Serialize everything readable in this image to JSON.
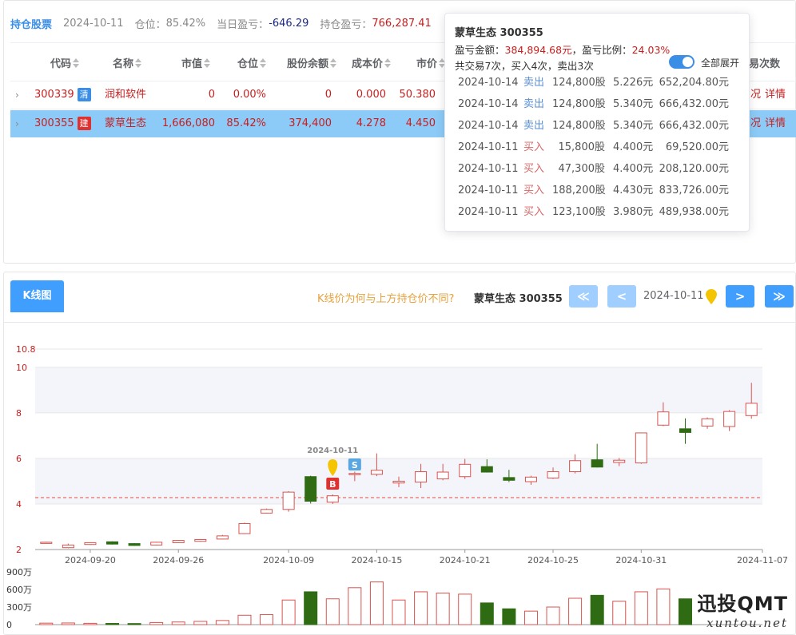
{
  "summary": {
    "title": "持仓股票",
    "date": "2024-10-11",
    "position_label": "仓位：",
    "position_value": "85.42%",
    "daily_pnl_label": "当日盈亏：",
    "daily_pnl_value": "-646.29",
    "holding_pnl_label": "持仓盈亏：",
    "holding_pnl_value": "766,287.41"
  },
  "table": {
    "headers": [
      "代码",
      "名称",
      "市值",
      "仓位",
      "股份余额",
      "成本价",
      "市价",
      "易次数"
    ],
    "rows": [
      {
        "code": "300339",
        "tag": "清",
        "name": "润和软件",
        "market_value": "0",
        "position": "0.00%",
        "shares": "0",
        "cost": "0.000",
        "price": "50.380",
        "action_suffix": "况",
        "detail": "详情"
      },
      {
        "code": "300355",
        "tag": "建",
        "name": "蒙草生态",
        "market_value": "1,666,080",
        "position": "85.42%",
        "shares": "374,400",
        "cost": "4.278",
        "price": "4.450",
        "action_suffix": "况",
        "detail": "详情"
      }
    ]
  },
  "popover": {
    "title": "蒙草生态 300355",
    "pnl_label": "盈亏金额：",
    "pnl_value": "384,894.68元",
    "ratio_label": "，盈亏比例：",
    "ratio_value": "24.03%",
    "trades_summary": "共交易7次，买入4次，卖出3次",
    "expand_all": "全部展开",
    "trades": [
      {
        "date": "2024-10-14",
        "type": "卖出",
        "qty": "124,800股",
        "price": "5.226元",
        "amount": "652,204.80元"
      },
      {
        "date": "2024-10-14",
        "type": "卖出",
        "qty": "124,800股",
        "price": "5.340元",
        "amount": "666,432.00元"
      },
      {
        "date": "2024-10-14",
        "type": "卖出",
        "qty": "124,800股",
        "price": "5.340元",
        "amount": "666,432.00元"
      },
      {
        "date": "2024-10-11",
        "type": "买入",
        "qty": "15,800股",
        "price": "4.400元",
        "amount": "69,520.00元"
      },
      {
        "date": "2024-10-11",
        "type": "买入",
        "qty": "47,300股",
        "price": "4.400元",
        "amount": "208,120.00元"
      },
      {
        "date": "2024-10-11",
        "type": "买入",
        "qty": "188,200股",
        "price": "4.430元",
        "amount": "833,726.00元"
      },
      {
        "date": "2024-10-11",
        "type": "买入",
        "qty": "123,100股",
        "price": "3.980元",
        "amount": "489,938.00元"
      }
    ]
  },
  "kline": {
    "tab": "K线图",
    "hint": "K线价为何与上方持仓价不同?",
    "stock": "蒙草生态 300355",
    "first_btn": "≪",
    "prev_btn": "<",
    "date": "2024-10-11",
    "next_btn": ">",
    "last_btn": "≫",
    "marker_date": "2024-10-11",
    "buy_marker": "B",
    "sell_marker": "S",
    "watermark_big": "迅投QMT",
    "watermark_small": "xuntou.net",
    "colors": {
      "up": "#d9534f",
      "down": "#2e6b12",
      "avg": "#e74c3c",
      "band": "#f3f5fb"
    }
  },
  "chart_data": {
    "type": "candlestick",
    "y_ticks": [
      "10.8",
      "10",
      "8",
      "6",
      "4",
      "2"
    ],
    "ylim": [
      2,
      10.8
    ],
    "reference_price": 4.278,
    "x_tick_labels": [
      "2024-09-20",
      "2024-09-26",
      "2024-10-09",
      "2024-10-15",
      "2024-10-21",
      "2024-10-25",
      "2024-10-31",
      "2024-11-07"
    ],
    "candles": [
      {
        "o": 2.28,
        "c": 2.32,
        "h": 2.34,
        "l": 2.26
      },
      {
        "o": 2.08,
        "c": 2.2,
        "h": 2.26,
        "l": 2.06
      },
      {
        "o": 2.22,
        "c": 2.3,
        "h": 2.32,
        "l": 2.2
      },
      {
        "o": 2.34,
        "c": 2.24,
        "h": 2.36,
        "l": 2.22
      },
      {
        "o": 2.26,
        "c": 2.18,
        "h": 2.28,
        "l": 2.16
      },
      {
        "o": 2.2,
        "c": 2.32,
        "h": 2.34,
        "l": 2.18
      },
      {
        "o": 2.3,
        "c": 2.4,
        "h": 2.42,
        "l": 2.28
      },
      {
        "o": 2.36,
        "c": 2.44,
        "h": 2.46,
        "l": 2.34
      },
      {
        "o": 2.46,
        "c": 2.6,
        "h": 2.64,
        "l": 2.44
      },
      {
        "o": 2.7,
        "c": 3.14,
        "h": 3.18,
        "l": 2.68
      },
      {
        "o": 3.6,
        "c": 3.76,
        "h": 3.8,
        "l": 3.58
      },
      {
        "o": 3.76,
        "c": 4.52,
        "h": 4.56,
        "l": 3.66
      },
      {
        "o": 5.2,
        "c": 4.12,
        "h": 5.24,
        "l": 4.02
      },
      {
        "o": 4.08,
        "c": 4.36,
        "h": 4.42,
        "l": 4.0
      },
      {
        "o": 5.34,
        "c": 5.34,
        "h": 5.42,
        "l": 5.0
      },
      {
        "o": 5.3,
        "c": 5.48,
        "h": 6.22,
        "l": 5.22
      },
      {
        "o": 4.92,
        "c": 5.0,
        "h": 5.2,
        "l": 4.74
      },
      {
        "o": 4.96,
        "c": 5.42,
        "h": 5.76,
        "l": 4.7
      },
      {
        "o": 5.1,
        "c": 5.4,
        "h": 5.76,
        "l": 5.04
      },
      {
        "o": 5.2,
        "c": 5.74,
        "h": 5.98,
        "l": 5.1
      },
      {
        "o": 5.64,
        "c": 5.4,
        "h": 5.96,
        "l": 5.38
      },
      {
        "o": 5.16,
        "c": 5.04,
        "h": 5.5,
        "l": 4.96
      },
      {
        "o": 4.98,
        "c": 5.18,
        "h": 5.24,
        "l": 4.84
      },
      {
        "o": 5.14,
        "c": 5.42,
        "h": 5.6,
        "l": 5.1
      },
      {
        "o": 5.42,
        "c": 5.9,
        "h": 6.18,
        "l": 5.34
      },
      {
        "o": 5.94,
        "c": 5.62,
        "h": 6.64,
        "l": 5.6
      },
      {
        "o": 5.82,
        "c": 5.92,
        "h": 6.02,
        "l": 5.66
      },
      {
        "o": 5.8,
        "c": 7.12,
        "h": 7.14,
        "l": 5.76
      },
      {
        "o": 7.46,
        "c": 8.04,
        "h": 8.46,
        "l": 7.42
      },
      {
        "o": 7.3,
        "c": 7.14,
        "h": 7.76,
        "l": 6.64
      },
      {
        "o": 7.42,
        "c": 7.74,
        "h": 7.8,
        "l": 7.3
      },
      {
        "o": 7.4,
        "c": 8.06,
        "h": 8.12,
        "l": 7.2
      },
      {
        "o": 7.88,
        "c": 8.42,
        "h": 9.32,
        "l": 7.74
      }
    ],
    "volume_ticks": [
      "900万",
      "600万",
      "300万",
      "0"
    ],
    "volume_max": 900,
    "volumes": [
      25,
      28,
      22,
      20,
      18,
      35,
      45,
      55,
      70,
      160,
      170,
      420,
      560,
      440,
      630,
      730,
      420,
      560,
      540,
      520,
      370,
      270,
      230,
      300,
      450,
      500,
      400,
      560,
      610,
      440,
      0,
      0,
      0
    ]
  }
}
